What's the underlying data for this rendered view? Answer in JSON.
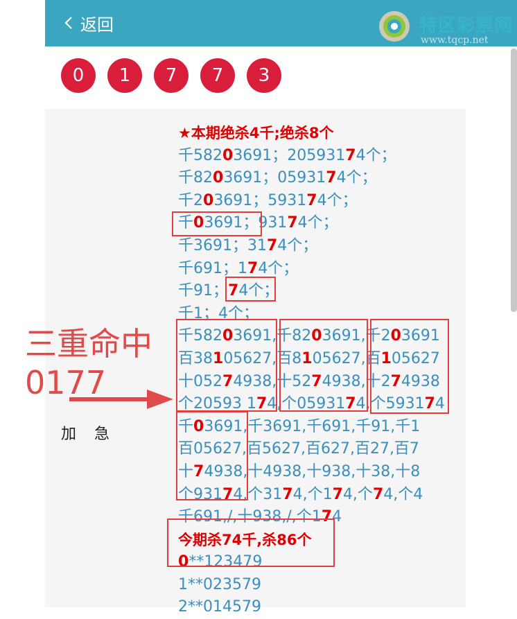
{
  "header": {
    "back_label": "返回",
    "logo_title": "特区彩票网",
    "logo_url": "www.tqcp.net"
  },
  "result_balls": [
    "0",
    "1",
    "7",
    "7",
    "3"
  ],
  "content_lines": [
    {
      "parts": [
        {
          "t": "★本期绝杀4千"
        },
        {
          "t": ";"
        },
        {
          "t": "绝杀8个"
        }
      ],
      "heading": true
    },
    {
      "parts": [
        {
          "t": "千582"
        },
        {
          "t": "0",
          "r": true
        },
        {
          "t": "3691；205931"
        },
        {
          "t": "7",
          "r": true
        },
        {
          "t": "4个；"
        }
      ]
    },
    {
      "parts": [
        {
          "t": "千82"
        },
        {
          "t": "0",
          "r": true
        },
        {
          "t": "3691；05931"
        },
        {
          "t": "7",
          "r": true
        },
        {
          "t": "4个；"
        }
      ]
    },
    {
      "parts": [
        {
          "t": "千2"
        },
        {
          "t": "0",
          "r": true
        },
        {
          "t": "3691；5931"
        },
        {
          "t": "7",
          "r": true
        },
        {
          "t": "4个；"
        }
      ]
    },
    {
      "parts": [
        {
          "t": "千"
        },
        {
          "t": "0",
          "r": true
        },
        {
          "t": "3691；931"
        },
        {
          "t": "7",
          "r": true
        },
        {
          "t": "4个；"
        }
      ]
    },
    {
      "parts": [
        {
          "t": "千3691；31"
        },
        {
          "t": "7",
          "r": true
        },
        {
          "t": "4个；"
        }
      ]
    },
    {
      "parts": [
        {
          "t": "千691；1"
        },
        {
          "t": "7",
          "r": true
        },
        {
          "t": "4个；"
        }
      ]
    },
    {
      "parts": [
        {
          "t": "千91；"
        },
        {
          "t": "7",
          "r": true
        },
        {
          "t": "4个；"
        }
      ]
    },
    {
      "parts": [
        {
          "t": "千1；4个；"
        }
      ]
    },
    {
      "parts": [
        {
          "t": "千582"
        },
        {
          "t": "0",
          "r": true
        },
        {
          "t": "3691,千82"
        },
        {
          "t": "0",
          "r": true
        },
        {
          "t": "3691,千2"
        },
        {
          "t": "0",
          "r": true
        },
        {
          "t": "3691"
        }
      ]
    },
    {
      "parts": [
        {
          "t": "百38"
        },
        {
          "t": "1",
          "r": true
        },
        {
          "t": "05627,百8"
        },
        {
          "t": "1",
          "r": true
        },
        {
          "t": "05627,百"
        },
        {
          "t": "1",
          "r": true
        },
        {
          "t": "05627"
        }
      ]
    },
    {
      "parts": [
        {
          "t": "十052"
        },
        {
          "t": "7",
          "r": true
        },
        {
          "t": "4938,十52"
        },
        {
          "t": "7",
          "r": true
        },
        {
          "t": "4938,十2"
        },
        {
          "t": "7",
          "r": true
        },
        {
          "t": "4938"
        }
      ]
    },
    {
      "parts": [
        {
          "t": "个20593 1"
        },
        {
          "t": "7",
          "r": true
        },
        {
          "t": "4,个05931"
        },
        {
          "t": "7",
          "r": true
        },
        {
          "t": "4,个5931"
        },
        {
          "t": "7",
          "r": true
        },
        {
          "t": "4"
        }
      ]
    },
    {
      "parts": [
        {
          "t": "千"
        },
        {
          "t": "0",
          "r": true
        },
        {
          "t": "3691,千3691,千691,千91,千1"
        }
      ]
    },
    {
      "parts": [
        {
          "t": "百05627,百5627,百627,百27,百7"
        }
      ]
    },
    {
      "parts": [
        {
          "t": "十"
        },
        {
          "t": "7",
          "r": true
        },
        {
          "t": "4938,十4938,十938,十38,十8"
        }
      ]
    },
    {
      "parts": [
        {
          "t": "个931"
        },
        {
          "t": "7",
          "r": true
        },
        {
          "t": "4,个31"
        },
        {
          "t": "7",
          "r": true
        },
        {
          "t": "4,个1"
        },
        {
          "t": "7",
          "r": true
        },
        {
          "t": "4,个"
        },
        {
          "t": "7",
          "r": true
        },
        {
          "t": "4,个4"
        }
      ]
    },
    {
      "parts": [
        {
          "t": "千691,/,十938,/,个1"
        },
        {
          "t": "7",
          "r": true
        },
        {
          "t": "4"
        }
      ]
    },
    {
      "parts": [
        {
          "t": "今期杀74千"
        },
        {
          "t": ","
        },
        {
          "t": "杀86个"
        }
      ],
      "heading": true
    },
    {
      "parts": [
        {
          "t": "0",
          "r": true
        },
        {
          "t": "**12347"
        },
        {
          "t": "9"
        }
      ]
    },
    {
      "parts": [
        {
          "t": "1**023579"
        }
      ]
    },
    {
      "parts": [
        {
          "t": "2**014579"
        }
      ]
    }
  ],
  "annotation": {
    "line1": "三重命中",
    "line2": "0177"
  },
  "side_label": "加急",
  "colors": {
    "header_bg": "#3aa6c1",
    "ball": "#d81e3b",
    "text_blue": "#3a8fbf",
    "highlight_red": "#e00000",
    "annotation": "#e04a4a"
  }
}
